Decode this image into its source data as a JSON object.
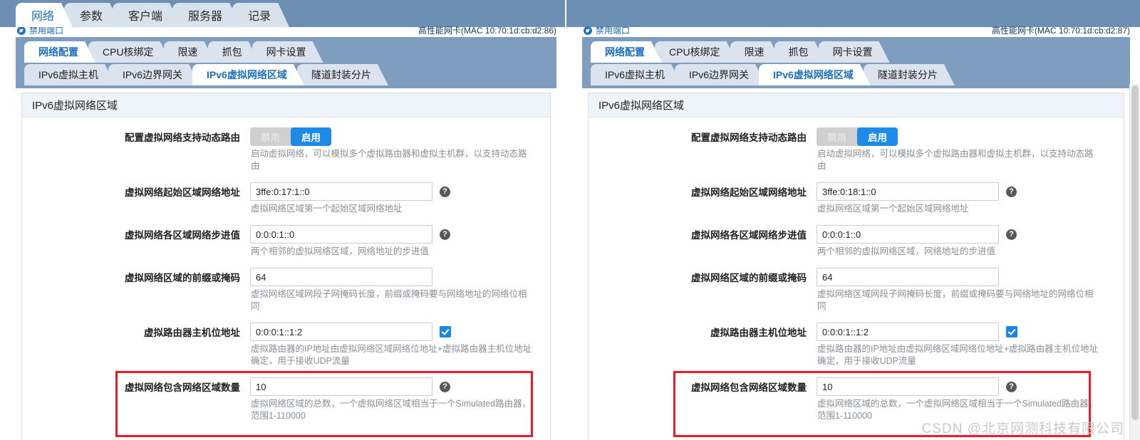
{
  "main_tabs": [
    {
      "label": "网络",
      "active": true
    },
    {
      "label": "参数",
      "active": false
    },
    {
      "label": "客户端",
      "active": false
    },
    {
      "label": "服务器",
      "active": false
    },
    {
      "label": "记录",
      "active": false
    }
  ],
  "status": {
    "port_label": "禁用端口",
    "port_icon": "check-circle-icon",
    "mac_left": "高性能网卡(MAC 10:70:1d:cb:d2:86)",
    "mac_right": "高性能网卡(MAC 10:70:1d:cb:d2:87)"
  },
  "sub_tabs_row1": [
    {
      "label": "网络配置",
      "active": true
    },
    {
      "label": "CPU核绑定",
      "active": false
    },
    {
      "label": "限速",
      "active": false
    },
    {
      "label": "抓包",
      "active": false
    },
    {
      "label": "网卡设置",
      "active": false
    }
  ],
  "sub_tabs_row2": [
    {
      "label": "IPv6虚拟主机",
      "active": false
    },
    {
      "label": "IPv6边界网关",
      "active": false
    },
    {
      "label": "IPv6虚拟网络区域",
      "active": true
    },
    {
      "label": "隧道封装分片",
      "active": false
    }
  ],
  "card": {
    "title": "IPv6虚拟网络区域"
  },
  "form": {
    "dynamic_route": {
      "label": "配置虚拟网络支持动态路由",
      "option_off": "禁用",
      "option_on": "启用",
      "selected": "启用",
      "hint": "启动虚拟网络，可以模拟多个虚拟路由器和虚拟主机群，以支持动态路由"
    },
    "start_zone_addr": {
      "label": "虚拟网络起始区域网络地址",
      "value_left": "3ffe:0:17:1::0",
      "value_right": "3ffe:0:18:1::0",
      "hint": "虚拟网络区域第一个起始区域网络地址",
      "help_icon": "question-mark-icon"
    },
    "step_value": {
      "label": "虚拟网络各区域网络步进值",
      "value": "0:0:0:1::0",
      "hint": "两个相邻的虚拟网络区域，网络地址的步进值",
      "help_icon": "question-mark-icon"
    },
    "prefix_mask": {
      "label": "虚拟网络区域的前缀或掩码",
      "value": "64",
      "hint": "虚拟网络区域网段子网掩码长度，前缀或掩码要与网络地址的网络位相同"
    },
    "router_host_addr": {
      "label": "虚拟路由器主机位地址",
      "value": "0:0:0:1::1:2",
      "checked": true,
      "hint": "虚拟路由器的IP地址由虚拟网络区域网络位地址+虚拟路由器主机位地址确定，用于接收UDP流量",
      "checkbox_icon": "checked-checkbox-icon"
    },
    "zone_count": {
      "label": "虚拟网络包含网络区域数量",
      "value": "10",
      "hint": "虚拟网络区域的总数，一个虚拟网络区域相当于一个Simulated路由器，范围1-110000",
      "help_icon": "question-mark-icon"
    }
  },
  "watermark": "CSDN @北京网测科技有限公司",
  "colors": {
    "main_tabbar": "#6e8fb4",
    "sub_tabbar": "#7f9dbe",
    "active_tab_text": "#1c6fbe",
    "toggle_on": "#1e8ae8",
    "highlight_red": "#ee1c25",
    "checkbox_blue": "#1a86e8"
  }
}
